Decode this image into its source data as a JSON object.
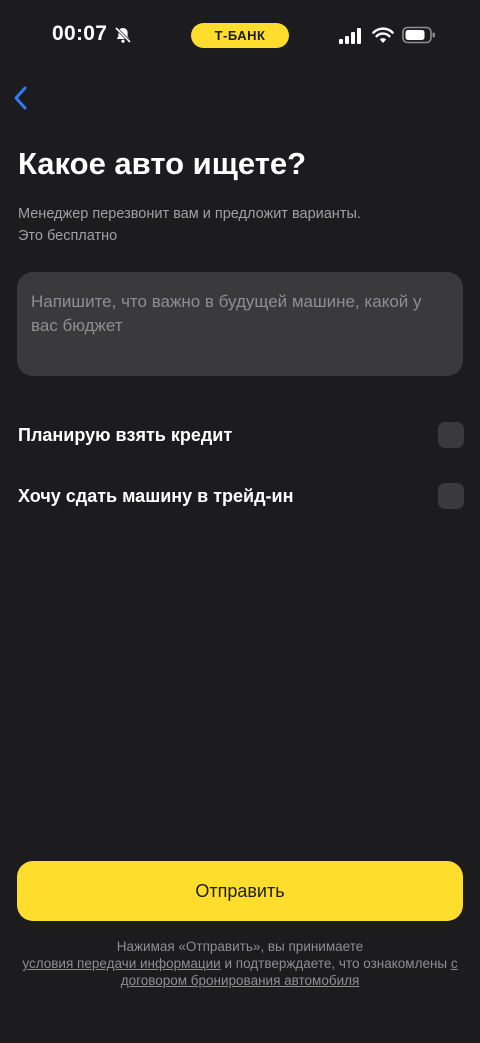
{
  "status_bar": {
    "time": "00:07",
    "brand": "Т-БАНК",
    "icons": [
      "bell-slash-icon",
      "signal-icon",
      "wifi-icon",
      "battery-icon"
    ],
    "brand_color": "#ffdd2d"
  },
  "nav": {
    "back_icon": "chevron-left-icon",
    "accent": "#3478f6"
  },
  "header": {
    "title": "Какое авто ищете?",
    "subtitle_line1": "Менеджер перезвонит вам и предложит варианты.",
    "subtitle_line2": "Это бесплатно"
  },
  "form": {
    "textarea_placeholder": "Напишите, что важно в будущей машине, какой у вас бюджет",
    "options": [
      {
        "label": "Планирую взять кредит",
        "checked": false
      },
      {
        "label": "Хочу сдать машину в трейд-ин",
        "checked": false
      }
    ],
    "submit_label": "Отправить"
  },
  "legal": {
    "prefix": "Нажимая «Отправить», вы принимаете",
    "link1": "условия передачи информации",
    "middle": " и подтверждаете, что ознакомлены ",
    "link2": "с договором бронирования автомобиля"
  }
}
